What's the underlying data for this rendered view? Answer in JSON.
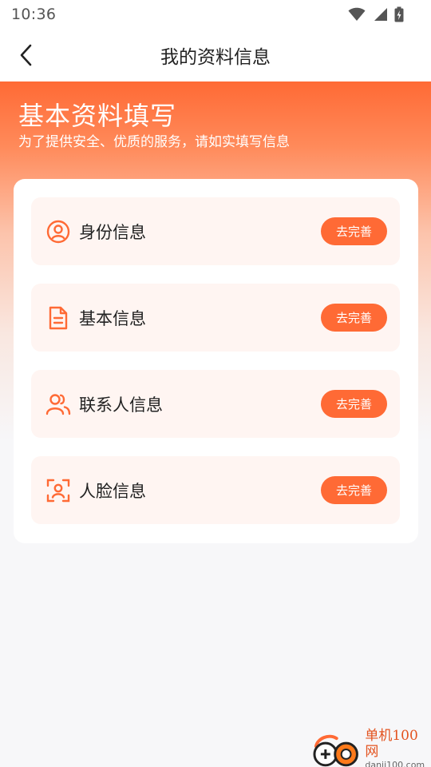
{
  "status_bar": {
    "time": "10:36",
    "icons": [
      "wifi-icon",
      "signal-icon",
      "battery-icon"
    ]
  },
  "nav": {
    "back_icon": "chevron-left-icon",
    "title": "我的资料信息"
  },
  "hero": {
    "title": "基本资料填写",
    "subtitle": "为了提供安全、优质的服务，请如实填写信息"
  },
  "colors": {
    "accent": "#ff6a35",
    "item_background": "#fff5f2"
  },
  "items": [
    {
      "icon": "user-circle-icon",
      "label": "身份信息",
      "button": "去完善"
    },
    {
      "icon": "document-icon",
      "label": "基本信息",
      "button": "去完善"
    },
    {
      "icon": "contacts-icon",
      "label": "联系人信息",
      "button": "去完善"
    },
    {
      "icon": "face-scan-icon",
      "label": "人脸信息",
      "button": "去完善"
    }
  ],
  "watermark": {
    "name": "单机100网",
    "url": "danji100.com"
  }
}
